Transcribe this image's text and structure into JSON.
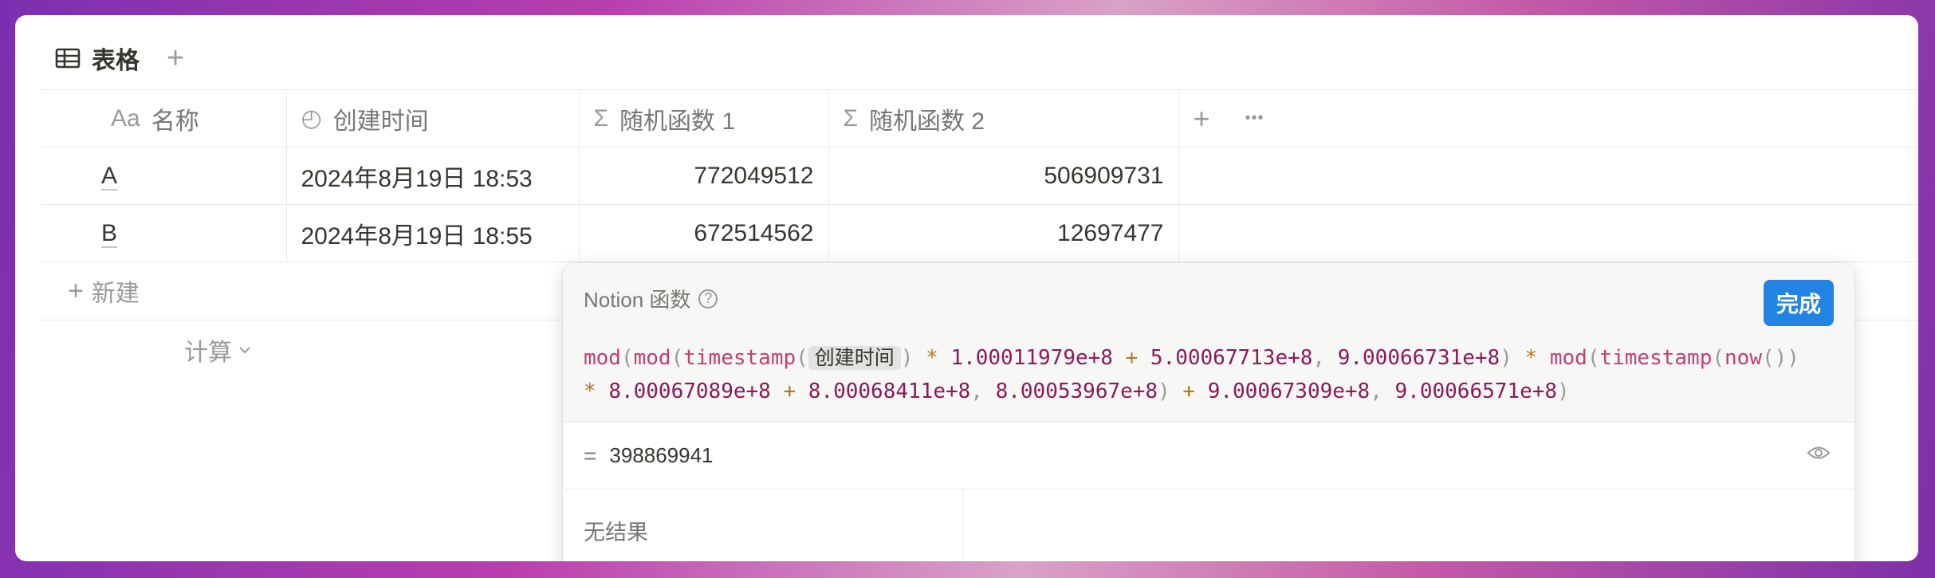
{
  "view": {
    "title": "表格",
    "add_icon": "+"
  },
  "table": {
    "headers": [
      {
        "icon": "Aa",
        "label": "名称"
      },
      {
        "icon": "◴",
        "label": "创建时间"
      },
      {
        "icon": "Σ",
        "label": "随机函数 1"
      },
      {
        "icon": "Σ",
        "label": "随机函数 2"
      }
    ],
    "header_add": "+",
    "header_more": "•••",
    "rows": [
      {
        "name": "A",
        "created": "2024年8月19日 18:53",
        "r1": "772049512",
        "r2": "506909731"
      },
      {
        "name": "B",
        "created": "2024年8月19日 18:55",
        "r1": "672514562",
        "r2": "12697477"
      }
    ],
    "new_row_label": "新建",
    "calc_label": "计算"
  },
  "formula_panel": {
    "title": "Notion 函数",
    "help_icon": "?",
    "done_label": "完成",
    "formula": {
      "t1": "mod",
      "t2": "(",
      "t3": "mod",
      "t4": "(",
      "t5": "timestamp",
      "t6": "(",
      "prop": "创建时间",
      "t7": ")",
      "t8": " * ",
      "t9": "1.00011979e+8",
      "t10": " + ",
      "t11": "5.00067713e+8",
      "t12": ", ",
      "t13": "9.00066731e+8",
      "t14": ")",
      "t15": " * ",
      "t16": "mod",
      "t17": "(",
      "t18": "timestamp",
      "t19": "(",
      "t20": "now",
      "t21": "())",
      "t22": "* ",
      "t23": "8.00067089e+8",
      "t24": " + ",
      "t25": "8.00068411e+8",
      "t26": ", ",
      "t27": "8.00053967e+8",
      "t28": ")",
      "t29": " + ",
      "t30": "9.00067309e+8",
      "t31": ", ",
      "t32": "9.00066571e+8",
      "t33": ")"
    },
    "result_prefix": "=",
    "result_value": "398869941",
    "no_result_label": "无结果"
  },
  "colors": {
    "accent": "#2383e2",
    "function": "#c23e73",
    "number": "#8b1a5a",
    "operator": "#b07a1e"
  }
}
